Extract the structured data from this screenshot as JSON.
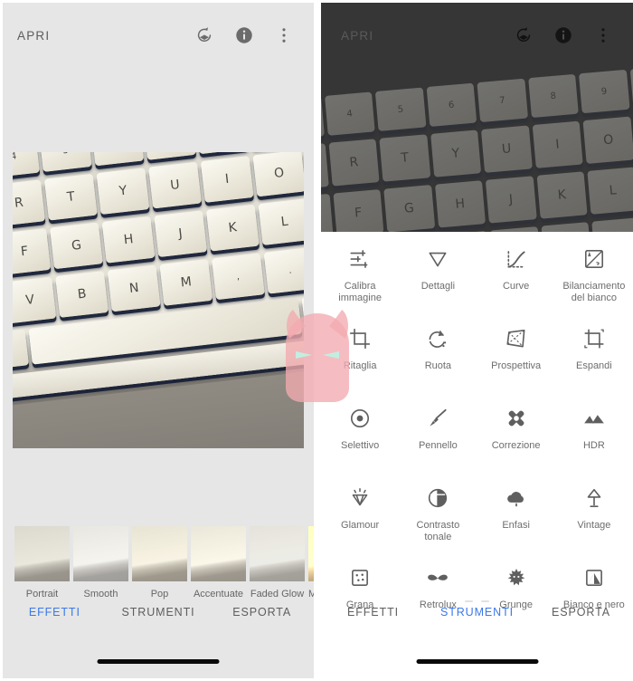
{
  "left": {
    "appbar": {
      "title": "APRI",
      "icons": [
        {
          "name": "undo-layers-icon"
        },
        {
          "name": "info-icon"
        },
        {
          "name": "overflow-menu-icon"
        }
      ]
    },
    "photo": {
      "alt": "white laptop keyboard photo"
    },
    "filters": [
      {
        "label": "Portrait"
      },
      {
        "label": "Smooth"
      },
      {
        "label": "Pop"
      },
      {
        "label": "Accentuate"
      },
      {
        "label": "Faded Glow"
      },
      {
        "label": "M"
      }
    ],
    "tabs": [
      {
        "label": "EFFETTI",
        "active": true
      },
      {
        "label": "STRUMENTI",
        "active": false
      },
      {
        "label": "ESPORTA",
        "active": false
      }
    ]
  },
  "right": {
    "appbar": {
      "title": "APRI",
      "icons": [
        {
          "name": "undo-layers-icon"
        },
        {
          "name": "info-icon"
        },
        {
          "name": "overflow-menu-icon"
        }
      ]
    },
    "tools": [
      {
        "label": "Calibra immagine",
        "icon": "tune-sliders-icon"
      },
      {
        "label": "Dettagli",
        "icon": "triangle-down-icon"
      },
      {
        "label": "Curve",
        "icon": "curves-icon"
      },
      {
        "label": "Bilanciamento del bianco",
        "icon": "white-balance-icon"
      },
      {
        "label": "Ritaglia",
        "icon": "crop-icon"
      },
      {
        "label": "Ruota",
        "icon": "rotate-icon"
      },
      {
        "label": "Prospettiva",
        "icon": "perspective-icon"
      },
      {
        "label": "Espandi",
        "icon": "expand-icon"
      },
      {
        "label": "Selettivo",
        "icon": "selective-icon"
      },
      {
        "label": "Pennello",
        "icon": "brush-icon"
      },
      {
        "label": "Correzione",
        "icon": "healing-icon"
      },
      {
        "label": "HDR",
        "icon": "mountains-icon"
      },
      {
        "label": "Glamour",
        "icon": "glamour-gem-icon"
      },
      {
        "label": "Contrasto tonale",
        "icon": "tonal-contrast-icon"
      },
      {
        "label": "Enfasi",
        "icon": "drama-cloud-icon"
      },
      {
        "label": "Vintage",
        "icon": "vintage-lamp-icon"
      },
      {
        "label": "Grana",
        "icon": "grain-icon"
      },
      {
        "label": "Retrolux",
        "icon": "moustache-icon"
      },
      {
        "label": "Grunge",
        "icon": "grunge-icon"
      },
      {
        "label": "Bianco e nero",
        "icon": "black-white-icon"
      }
    ],
    "pagination": {
      "dots": 2,
      "active": 0
    },
    "tabs": [
      {
        "label": "EFFETTI",
        "active": false
      },
      {
        "label": "STRUMENTI",
        "active": true
      },
      {
        "label": "ESPORTA",
        "active": false
      }
    ]
  },
  "colors": {
    "accent": "#3b78e7",
    "left_bg": "#e6e6e6",
    "dark_bg": "#363636",
    "label": "#6d6d6d",
    "watermark": "#f3b0b4"
  }
}
